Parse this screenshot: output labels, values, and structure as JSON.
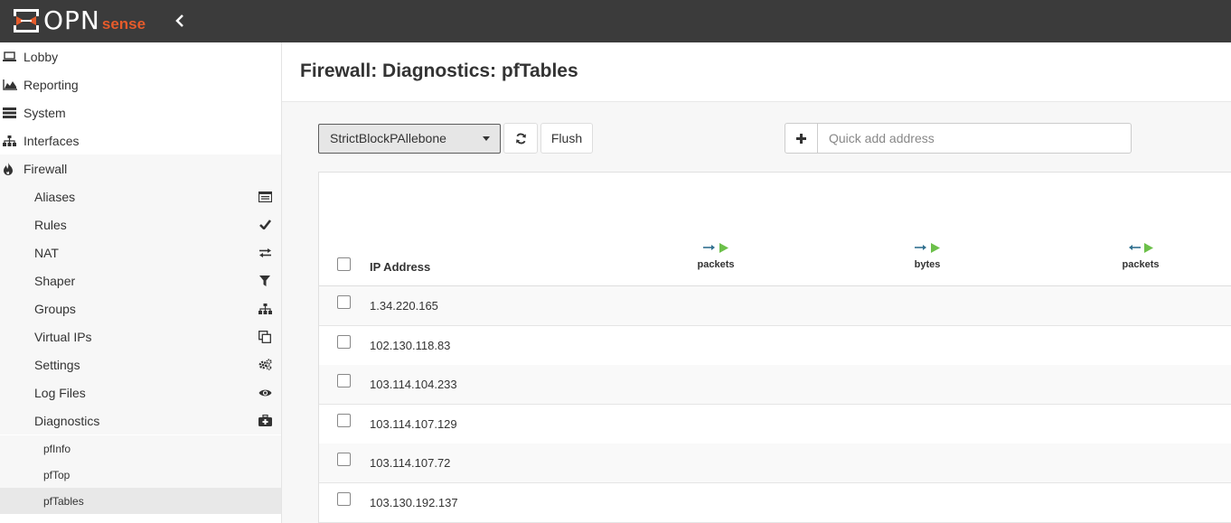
{
  "brand": {
    "part1": "OPN",
    "part2": "sense"
  },
  "sidebar": {
    "top": [
      {
        "label": "Lobby",
        "icon": "laptop-icon"
      },
      {
        "label": "Reporting",
        "icon": "area-chart-icon"
      },
      {
        "label": "System",
        "icon": "server-icon"
      },
      {
        "label": "Interfaces",
        "icon": "sitemap-icon"
      },
      {
        "label": "Firewall",
        "icon": "fire-icon"
      }
    ],
    "firewall_items": [
      {
        "label": "Aliases",
        "icon": "list-alt-icon"
      },
      {
        "label": "Rules",
        "icon": "check-icon"
      },
      {
        "label": "NAT",
        "icon": "exchange-icon"
      },
      {
        "label": "Shaper",
        "icon": "filter-icon"
      },
      {
        "label": "Groups",
        "icon": "sitemap-icon"
      },
      {
        "label": "Virtual IPs",
        "icon": "clone-icon"
      },
      {
        "label": "Settings",
        "icon": "cogs-icon"
      },
      {
        "label": "Log Files",
        "icon": "eye-icon"
      },
      {
        "label": "Diagnostics",
        "icon": "medkit-icon"
      }
    ],
    "diagnostics_items": [
      {
        "label": "pfInfo"
      },
      {
        "label": "pfTop"
      },
      {
        "label": "pfTables",
        "selected": true
      }
    ]
  },
  "page": {
    "title": "Firewall: Diagnostics: pfTables"
  },
  "toolbar": {
    "table_select_value": "StrictBlockPAllebone",
    "flush_label": "Flush",
    "quick_add_placeholder": "Quick add address"
  },
  "table": {
    "columns": {
      "ip": "IP Address",
      "c1": "packets",
      "c2": "bytes",
      "c3": "packets"
    },
    "rows": [
      "1.34.220.165",
      "102.130.118.83",
      "103.114.104.233",
      "103.114.107.129",
      "103.114.107.72",
      "103.130.192.137"
    ]
  },
  "colors": {
    "accent": "#e55b2b",
    "topbar": "#3b3b3b",
    "arrow_green": "#6cc04a",
    "arrow_blue": "#31708f"
  }
}
